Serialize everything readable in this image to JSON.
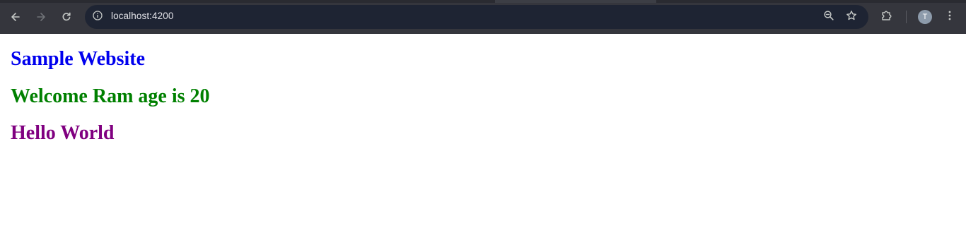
{
  "browser": {
    "address_bar": {
      "url": "localhost:4200"
    },
    "profile": {
      "initial": "T"
    },
    "icons": {
      "back": "back-arrow-icon",
      "forward": "forward-arrow-icon",
      "reload": "reload-icon",
      "site_info": "info-icon",
      "zoom": "zoom-out-icon",
      "bookmark": "star-icon",
      "extensions": "puzzle-piece-icon",
      "menu": "vertical-dots-icon"
    }
  },
  "page": {
    "headings": [
      {
        "text": "Sample Website",
        "color": "#0000ee"
      },
      {
        "text": "Welcome Ram age is 20",
        "color": "#008000"
      },
      {
        "text": "Hello World",
        "color": "#800080"
      }
    ]
  }
}
